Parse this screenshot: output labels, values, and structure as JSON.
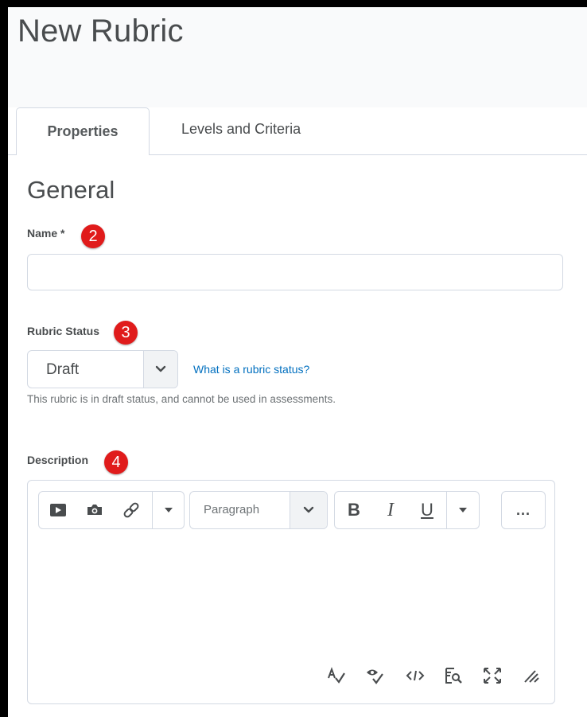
{
  "page": {
    "title": "New Rubric"
  },
  "tabs": [
    {
      "label": "Properties",
      "active": true
    },
    {
      "label": "Levels and Criteria",
      "active": false
    }
  ],
  "section": {
    "title": "General"
  },
  "name_field": {
    "label": "Name *",
    "value": "",
    "placeholder": ""
  },
  "status": {
    "label": "Rubric Status",
    "selected": "Draft",
    "help_link": "What is a rubric status?",
    "helper_text": "This rubric is in draft status, and cannot be used in assessments."
  },
  "description": {
    "label": "Description",
    "toolbar": {
      "insert_icons": [
        "video-icon",
        "camera-icon",
        "link-icon",
        "caret-down-icon"
      ],
      "paragraph_select": "Paragraph",
      "format_buttons": [
        "B",
        "I",
        "U"
      ],
      "more_label": "..."
    },
    "bottom_icons": [
      "spellcheck-icon",
      "accessibility-check-icon",
      "source-code-icon",
      "preview-icon",
      "fullscreen-icon",
      "resize-handle-icon"
    ]
  },
  "badges": [
    "2",
    "3",
    "4"
  ],
  "colors": {
    "badge": "#e01b1b",
    "link": "#006fbf",
    "border": "#d3d9e3",
    "text": "#494c4e"
  }
}
